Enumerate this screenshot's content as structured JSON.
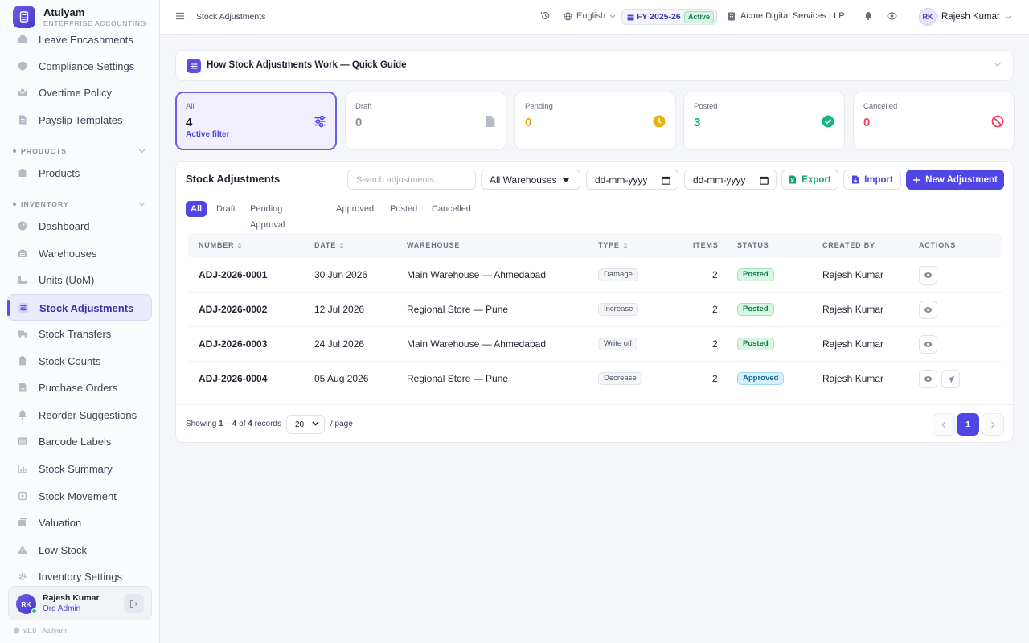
{
  "brand": {
    "name": "Atulyam",
    "subtitle": "ENTERPRISE ACCOUNTING"
  },
  "sidebar": {
    "items_top": [
      {
        "label": "Leave Encashments",
        "icon": "leave-icon"
      },
      {
        "label": "Compliance Settings",
        "icon": "shield-icon"
      },
      {
        "label": "Overtime Policy",
        "icon": "overtime-icon"
      },
      {
        "label": "Payslip Templates",
        "icon": "document-icon"
      }
    ],
    "section_products": "PRODUCTS",
    "products_items": [
      {
        "label": "Products",
        "icon": "box-icon"
      }
    ],
    "section_inventory": "INVENTORY",
    "inventory_items": [
      {
        "label": "Dashboard",
        "icon": "dashboard-icon"
      },
      {
        "label": "Warehouses",
        "icon": "warehouse-icon"
      },
      {
        "label": "Units (UoM)",
        "icon": "ruler-icon"
      },
      {
        "label": "Stock Adjustments",
        "icon": "sliders-icon"
      },
      {
        "label": "Stock Transfers",
        "icon": "truck-icon"
      },
      {
        "label": "Stock Counts",
        "icon": "clipboard-icon"
      },
      {
        "label": "Purchase Orders",
        "icon": "document-icon"
      },
      {
        "label": "Reorder Suggestions",
        "icon": "bell-icon"
      },
      {
        "label": "Barcode Labels",
        "icon": "barcode-icon"
      },
      {
        "label": "Stock Summary",
        "icon": "chart-icon"
      },
      {
        "label": "Stock Movement",
        "icon": "movement-icon"
      },
      {
        "label": "Valuation",
        "icon": "coins-icon"
      },
      {
        "label": "Low Stock",
        "icon": "warning-icon"
      },
      {
        "label": "Inventory Settings",
        "icon": "gear-icon"
      }
    ],
    "user": {
      "initials": "RK",
      "name": "Rajesh Kumar",
      "role": "Org Admin"
    },
    "version": "v1.0 · Atulyam"
  },
  "topbar": {
    "title": "Stock Adjustments",
    "language": "English",
    "fy": "FY 2025-26",
    "fy_status": "Active",
    "company": "Acme Digital Services LLP",
    "user_initials": "RK",
    "user_name": "Rajesh Kumar"
  },
  "guide": {
    "title": "How Stock Adjustments Work — Quick Guide"
  },
  "stats": [
    {
      "label": "All",
      "value": "4",
      "sub": "Active filter",
      "color": "#1f2430",
      "icon": "sliders-icon"
    },
    {
      "label": "Draft",
      "value": "0",
      "color": "#8b90a0",
      "icon": "file-icon"
    },
    {
      "label": "Pending",
      "value": "0",
      "color": "#e0a70b",
      "icon": "clock-icon"
    },
    {
      "label": "Posted",
      "value": "3",
      "color": "#10b981",
      "icon": "check-circle-icon"
    },
    {
      "label": "Cancelled",
      "value": "0",
      "color": "#f43f5e",
      "icon": "ban-icon"
    }
  ],
  "table_panel": {
    "title": "Stock Adjustments",
    "search_placeholder": "Search adjustments...",
    "warehouse_filter": "All Warehouses",
    "date_from": "dd-mm-yyyy",
    "date_to": "dd-mm-yyyy",
    "export_label": "Export",
    "import_label": "Import",
    "new_label": "New Adjustment",
    "tabs": [
      "All",
      "Draft",
      "Pending Approval",
      "Approved",
      "Posted",
      "Cancelled"
    ],
    "columns": [
      "NUMBER",
      "DATE",
      "WAREHOUSE",
      "TYPE",
      "ITEMS",
      "STATUS",
      "CREATED BY",
      "ACTIONS"
    ],
    "rows": [
      {
        "number": "ADJ-2026-0001",
        "date": "30 Jun 2026",
        "warehouse": "Main Warehouse — Ahmedabad",
        "type": "Damage",
        "items": "2",
        "status": "Posted",
        "created_by": "Rajesh Kumar"
      },
      {
        "number": "ADJ-2026-0002",
        "date": "12 Jul 2026",
        "warehouse": "Regional Store — Pune",
        "type": "Increase",
        "items": "2",
        "status": "Posted",
        "created_by": "Rajesh Kumar"
      },
      {
        "number": "ADJ-2026-0003",
        "date": "24 Jul 2026",
        "warehouse": "Main Warehouse — Ahmedabad",
        "type": "Write off",
        "items": "2",
        "status": "Posted",
        "created_by": "Rajesh Kumar"
      },
      {
        "number": "ADJ-2026-0004",
        "date": "05 Aug 2026",
        "warehouse": "Regional Store — Pune",
        "type": "Decrease",
        "items": "2",
        "status": "Approved",
        "created_by": "Rajesh Kumar"
      }
    ],
    "pagination": {
      "showing_prefix": "Showing ",
      "range_start": "1",
      "range_sep": " – ",
      "range_end": "4",
      "of": " of ",
      "total": "4",
      "records": " records",
      "per_page": "20",
      "per_page_label": "/ page",
      "current_page": "1"
    }
  }
}
